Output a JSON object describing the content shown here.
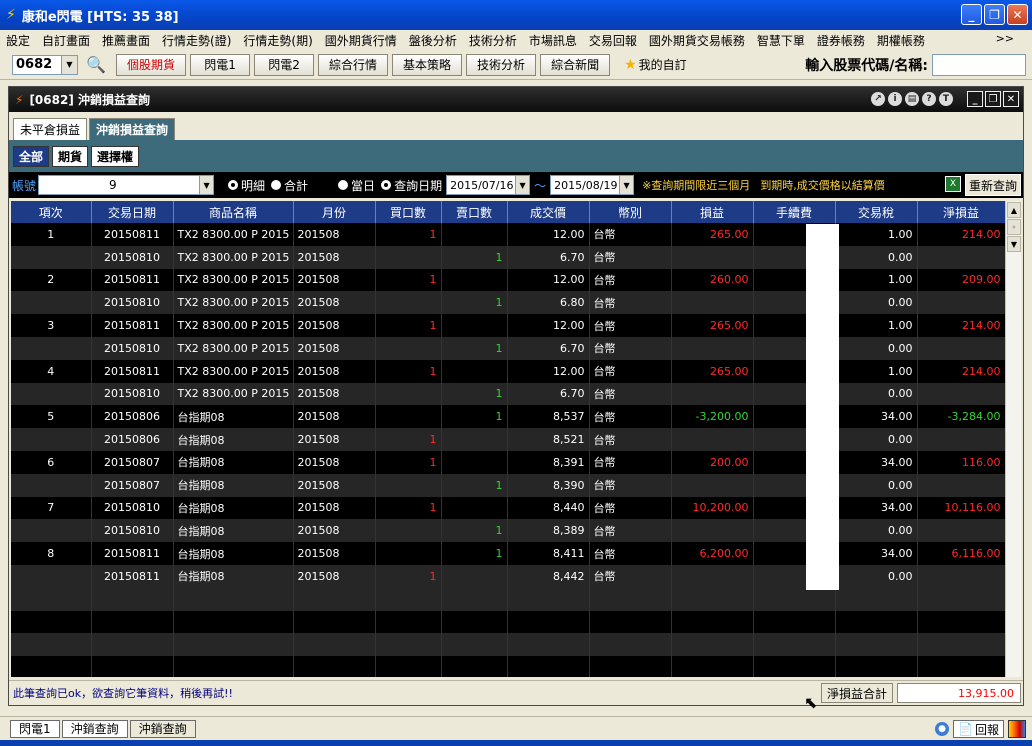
{
  "app": {
    "title": "康和e閃電 [HTS: 35 38]"
  },
  "menu": [
    "設定",
    "自訂畫面",
    "推薦畫面",
    "行情走勢(證)",
    "行情走勢(期)",
    "國外期貨行情",
    "盤後分析",
    "技術分析",
    "市場訊息",
    "交易回報",
    "國外期貨交易帳務",
    "智慧下單",
    "證券帳務",
    "期權帳務"
  ],
  "menu_more": ">>",
  "toolbar": {
    "code": "0682",
    "buttons": [
      "個股期貨",
      "閃電1",
      "閃電2",
      "綜合行情",
      "基本策略",
      "技術分析",
      "綜合新聞"
    ],
    "favorites": "我的自訂",
    "stock_label": "輸入股票代碼/名稱:"
  },
  "inner": {
    "title": "[0682] 沖銷損益查詢",
    "tabs": [
      "未平倉損益",
      "沖銷損益查詢"
    ],
    "subtabs": [
      "全部",
      "期貨",
      "選擇權"
    ]
  },
  "filter": {
    "account_label": "帳號",
    "account": "9",
    "radio_detail": "明細",
    "radio_total": "合計",
    "radio_today": "當日",
    "radio_query": "查詢日期",
    "date_from": "2015/07/16",
    "tilde": "～",
    "date_to": "2015/08/19",
    "note1": "※查詢期間限近三個月",
    "note2": "到期時,成交價格以結算價",
    "refresh": "重新查詢"
  },
  "columns": [
    "項次",
    "交易日期",
    "商品名稱",
    "月份",
    "買口數",
    "賣口數",
    "成交價",
    "幣別",
    "損益",
    "手續費",
    "交易稅",
    "淨損益"
  ],
  "rows": [
    {
      "idx": "1",
      "date": "20150811",
      "name": "TX2 8300.00 P 2015",
      "month": "201508",
      "buy": "1",
      "sell": "",
      "price": "12.00",
      "cur": "台幣",
      "pl": "265.00",
      "fee": "",
      "tax": "1.00",
      "net": "214.00"
    },
    {
      "idx": "",
      "date": "20150810",
      "name": "TX2 8300.00 P 2015",
      "month": "201508",
      "buy": "",
      "sell": "1",
      "price": "6.70",
      "cur": "台幣",
      "pl": "",
      "fee": "",
      "tax": "0.00",
      "net": ""
    },
    {
      "idx": "2",
      "date": "20150811",
      "name": "TX2 8300.00 P 2015",
      "month": "201508",
      "buy": "1",
      "sell": "",
      "price": "12.00",
      "cur": "台幣",
      "pl": "260.00",
      "fee": "",
      "tax": "1.00",
      "net": "209.00"
    },
    {
      "idx": "",
      "date": "20150810",
      "name": "TX2 8300.00 P 2015",
      "month": "201508",
      "buy": "",
      "sell": "1",
      "price": "6.80",
      "cur": "台幣",
      "pl": "",
      "fee": "",
      "tax": "0.00",
      "net": ""
    },
    {
      "idx": "3",
      "date": "20150811",
      "name": "TX2 8300.00 P 2015",
      "month": "201508",
      "buy": "1",
      "sell": "",
      "price": "12.00",
      "cur": "台幣",
      "pl": "265.00",
      "fee": "",
      "tax": "1.00",
      "net": "214.00"
    },
    {
      "idx": "",
      "date": "20150810",
      "name": "TX2 8300.00 P 2015",
      "month": "201508",
      "buy": "",
      "sell": "1",
      "price": "6.70",
      "cur": "台幣",
      "pl": "",
      "fee": "",
      "tax": "0.00",
      "net": ""
    },
    {
      "idx": "4",
      "date": "20150811",
      "name": "TX2 8300.00 P 2015",
      "month": "201508",
      "buy": "1",
      "sell": "",
      "price": "12.00",
      "cur": "台幣",
      "pl": "265.00",
      "fee": "",
      "tax": "1.00",
      "net": "214.00"
    },
    {
      "idx": "",
      "date": "20150810",
      "name": "TX2 8300.00 P 2015",
      "month": "201508",
      "buy": "",
      "sell": "1",
      "price": "6.70",
      "cur": "台幣",
      "pl": "",
      "fee": "",
      "tax": "0.00",
      "net": ""
    },
    {
      "idx": "5",
      "date": "20150806",
      "name": "台指期08",
      "month": "201508",
      "buy": "",
      "sell": "1",
      "price": "8,537",
      "cur": "台幣",
      "pl": "-3,200.00",
      "fee": "",
      "tax": "34.00",
      "net": "-3,284.00"
    },
    {
      "idx": "",
      "date": "20150806",
      "name": "台指期08",
      "month": "201508",
      "buy": "1",
      "sell": "",
      "price": "8,521",
      "cur": "台幣",
      "pl": "",
      "fee": "",
      "tax": "0.00",
      "net": ""
    },
    {
      "idx": "6",
      "date": "20150807",
      "name": "台指期08",
      "month": "201508",
      "buy": "1",
      "sell": "",
      "price": "8,391",
      "cur": "台幣",
      "pl": "200.00",
      "fee": "",
      "tax": "34.00",
      "net": "116.00"
    },
    {
      "idx": "",
      "date": "20150807",
      "name": "台指期08",
      "month": "201508",
      "buy": "",
      "sell": "1",
      "price": "8,390",
      "cur": "台幣",
      "pl": "",
      "fee": "",
      "tax": "0.00",
      "net": ""
    },
    {
      "idx": "7",
      "date": "20150810",
      "name": "台指期08",
      "month": "201508",
      "buy": "1",
      "sell": "",
      "price": "8,440",
      "cur": "台幣",
      "pl": "10,200.00",
      "fee": "",
      "tax": "34.00",
      "net": "10,116.00"
    },
    {
      "idx": "",
      "date": "20150810",
      "name": "台指期08",
      "month": "201508",
      "buy": "",
      "sell": "1",
      "price": "8,389",
      "cur": "台幣",
      "pl": "",
      "fee": "",
      "tax": "0.00",
      "net": ""
    },
    {
      "idx": "8",
      "date": "20150811",
      "name": "台指期08",
      "month": "201508",
      "buy": "",
      "sell": "1",
      "price": "8,411",
      "cur": "台幣",
      "pl": "6,200.00",
      "fee": "",
      "tax": "34.00",
      "net": "6,116.00"
    },
    {
      "idx": "",
      "date": "20150811",
      "name": "台指期08",
      "month": "201508",
      "buy": "1",
      "sell": "",
      "price": "8,442",
      "cur": "台幣",
      "pl": "",
      "fee": "",
      "tax": "0.00",
      "net": ""
    }
  ],
  "empty_rows": 4,
  "status": {
    "message": "此筆查詢已ok，欲查詢它筆資料，稍後再試!!",
    "total_label": "淨損益合計",
    "total_value": "13,915.00"
  },
  "taskbar": {
    "tabs": [
      "閃電1",
      "沖銷查詢",
      "沖銷查詢"
    ],
    "reply": "回報"
  },
  "colors": {
    "positive": "#ff2a2a",
    "negative": "#35d435",
    "header": "#1e3b88"
  }
}
